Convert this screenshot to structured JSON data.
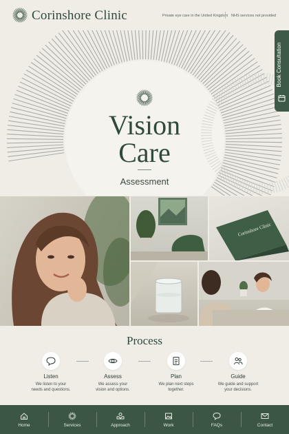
{
  "header": {
    "brand": "Corinshore Clinic",
    "tagline_left": "Private eye care in the United Kingdom",
    "tagline_right": "NHS services not provided"
  },
  "hero": {
    "title_line1": "Vision",
    "title_line2": "Care",
    "subtitle": "Assessment"
  },
  "book_tab": {
    "label": "Book Consultation",
    "icon": "calendar-icon"
  },
  "photos": {
    "card_text": "Corinshore Clinic"
  },
  "process": {
    "title": "Process",
    "steps": [
      {
        "icon": "speech-bubble-icon",
        "title": "Listen",
        "desc1": "We listen to your",
        "desc2": "needs and questions."
      },
      {
        "icon": "eye-icon",
        "title": "Assess",
        "desc1": "We assess your",
        "desc2": "vision and options."
      },
      {
        "icon": "document-icon",
        "title": "Plan",
        "desc1": "We plan next steps",
        "desc2": "together."
      },
      {
        "icon": "people-icon",
        "title": "Guide",
        "desc1": "We guide and support",
        "desc2": "your decisions."
      }
    ]
  },
  "nav": {
    "items": [
      {
        "label": "Home",
        "icon": "home-icon"
      },
      {
        "label": "Services",
        "icon": "sunburst-icon"
      },
      {
        "label": "Approach",
        "icon": "hands-icon"
      },
      {
        "label": "Work",
        "icon": "image-icon"
      },
      {
        "label": "FAQs",
        "icon": "chat-icon"
      },
      {
        "label": "Contact",
        "icon": "mail-icon"
      }
    ]
  },
  "colors": {
    "brand_green": "#3b5643",
    "background": "#efede6"
  }
}
